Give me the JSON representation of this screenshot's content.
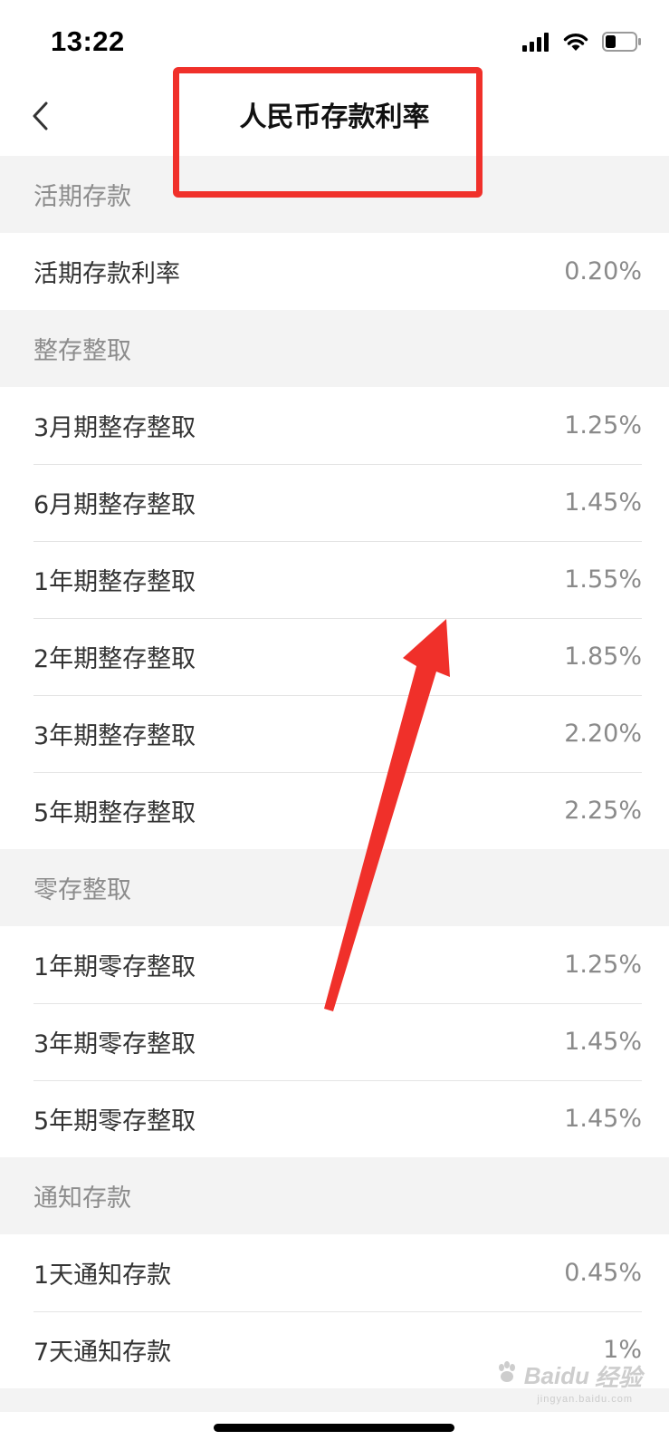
{
  "status_bar": {
    "time": "13:22",
    "icons": [
      "signal-icon",
      "wifi-icon",
      "battery-icon"
    ]
  },
  "nav": {
    "back_icon": "chevron-left-icon",
    "title": "人民币存款利率"
  },
  "sections": [
    {
      "header": "活期存款",
      "rows": [
        {
          "label": "活期存款利率",
          "value": "0.20%"
        }
      ]
    },
    {
      "header": "整存整取",
      "rows": [
        {
          "label": "3月期整存整取",
          "value": "1.25%"
        },
        {
          "label": "6月期整存整取",
          "value": "1.45%"
        },
        {
          "label": "1年期整存整取",
          "value": "1.55%"
        },
        {
          "label": "2年期整存整取",
          "value": "1.85%"
        },
        {
          "label": "3年期整存整取",
          "value": "2.20%"
        },
        {
          "label": "5年期整存整取",
          "value": "2.25%"
        }
      ]
    },
    {
      "header": "零存整取",
      "rows": [
        {
          "label": "1年期零存整取",
          "value": "1.25%"
        },
        {
          "label": "3年期零存整取",
          "value": "1.45%"
        },
        {
          "label": "5年期零存整取",
          "value": "1.45%"
        }
      ]
    },
    {
      "header": "通知存款",
      "rows": [
        {
          "label": "1天通知存款",
          "value": "0.45%"
        },
        {
          "label": "7天通知存款",
          "value": "1%"
        }
      ]
    }
  ],
  "annotations": {
    "highlight_color": "#f0302a"
  },
  "watermark": {
    "brand": "Baidu",
    "suffix": "经验",
    "sub": "jingyan.baidu.com"
  }
}
